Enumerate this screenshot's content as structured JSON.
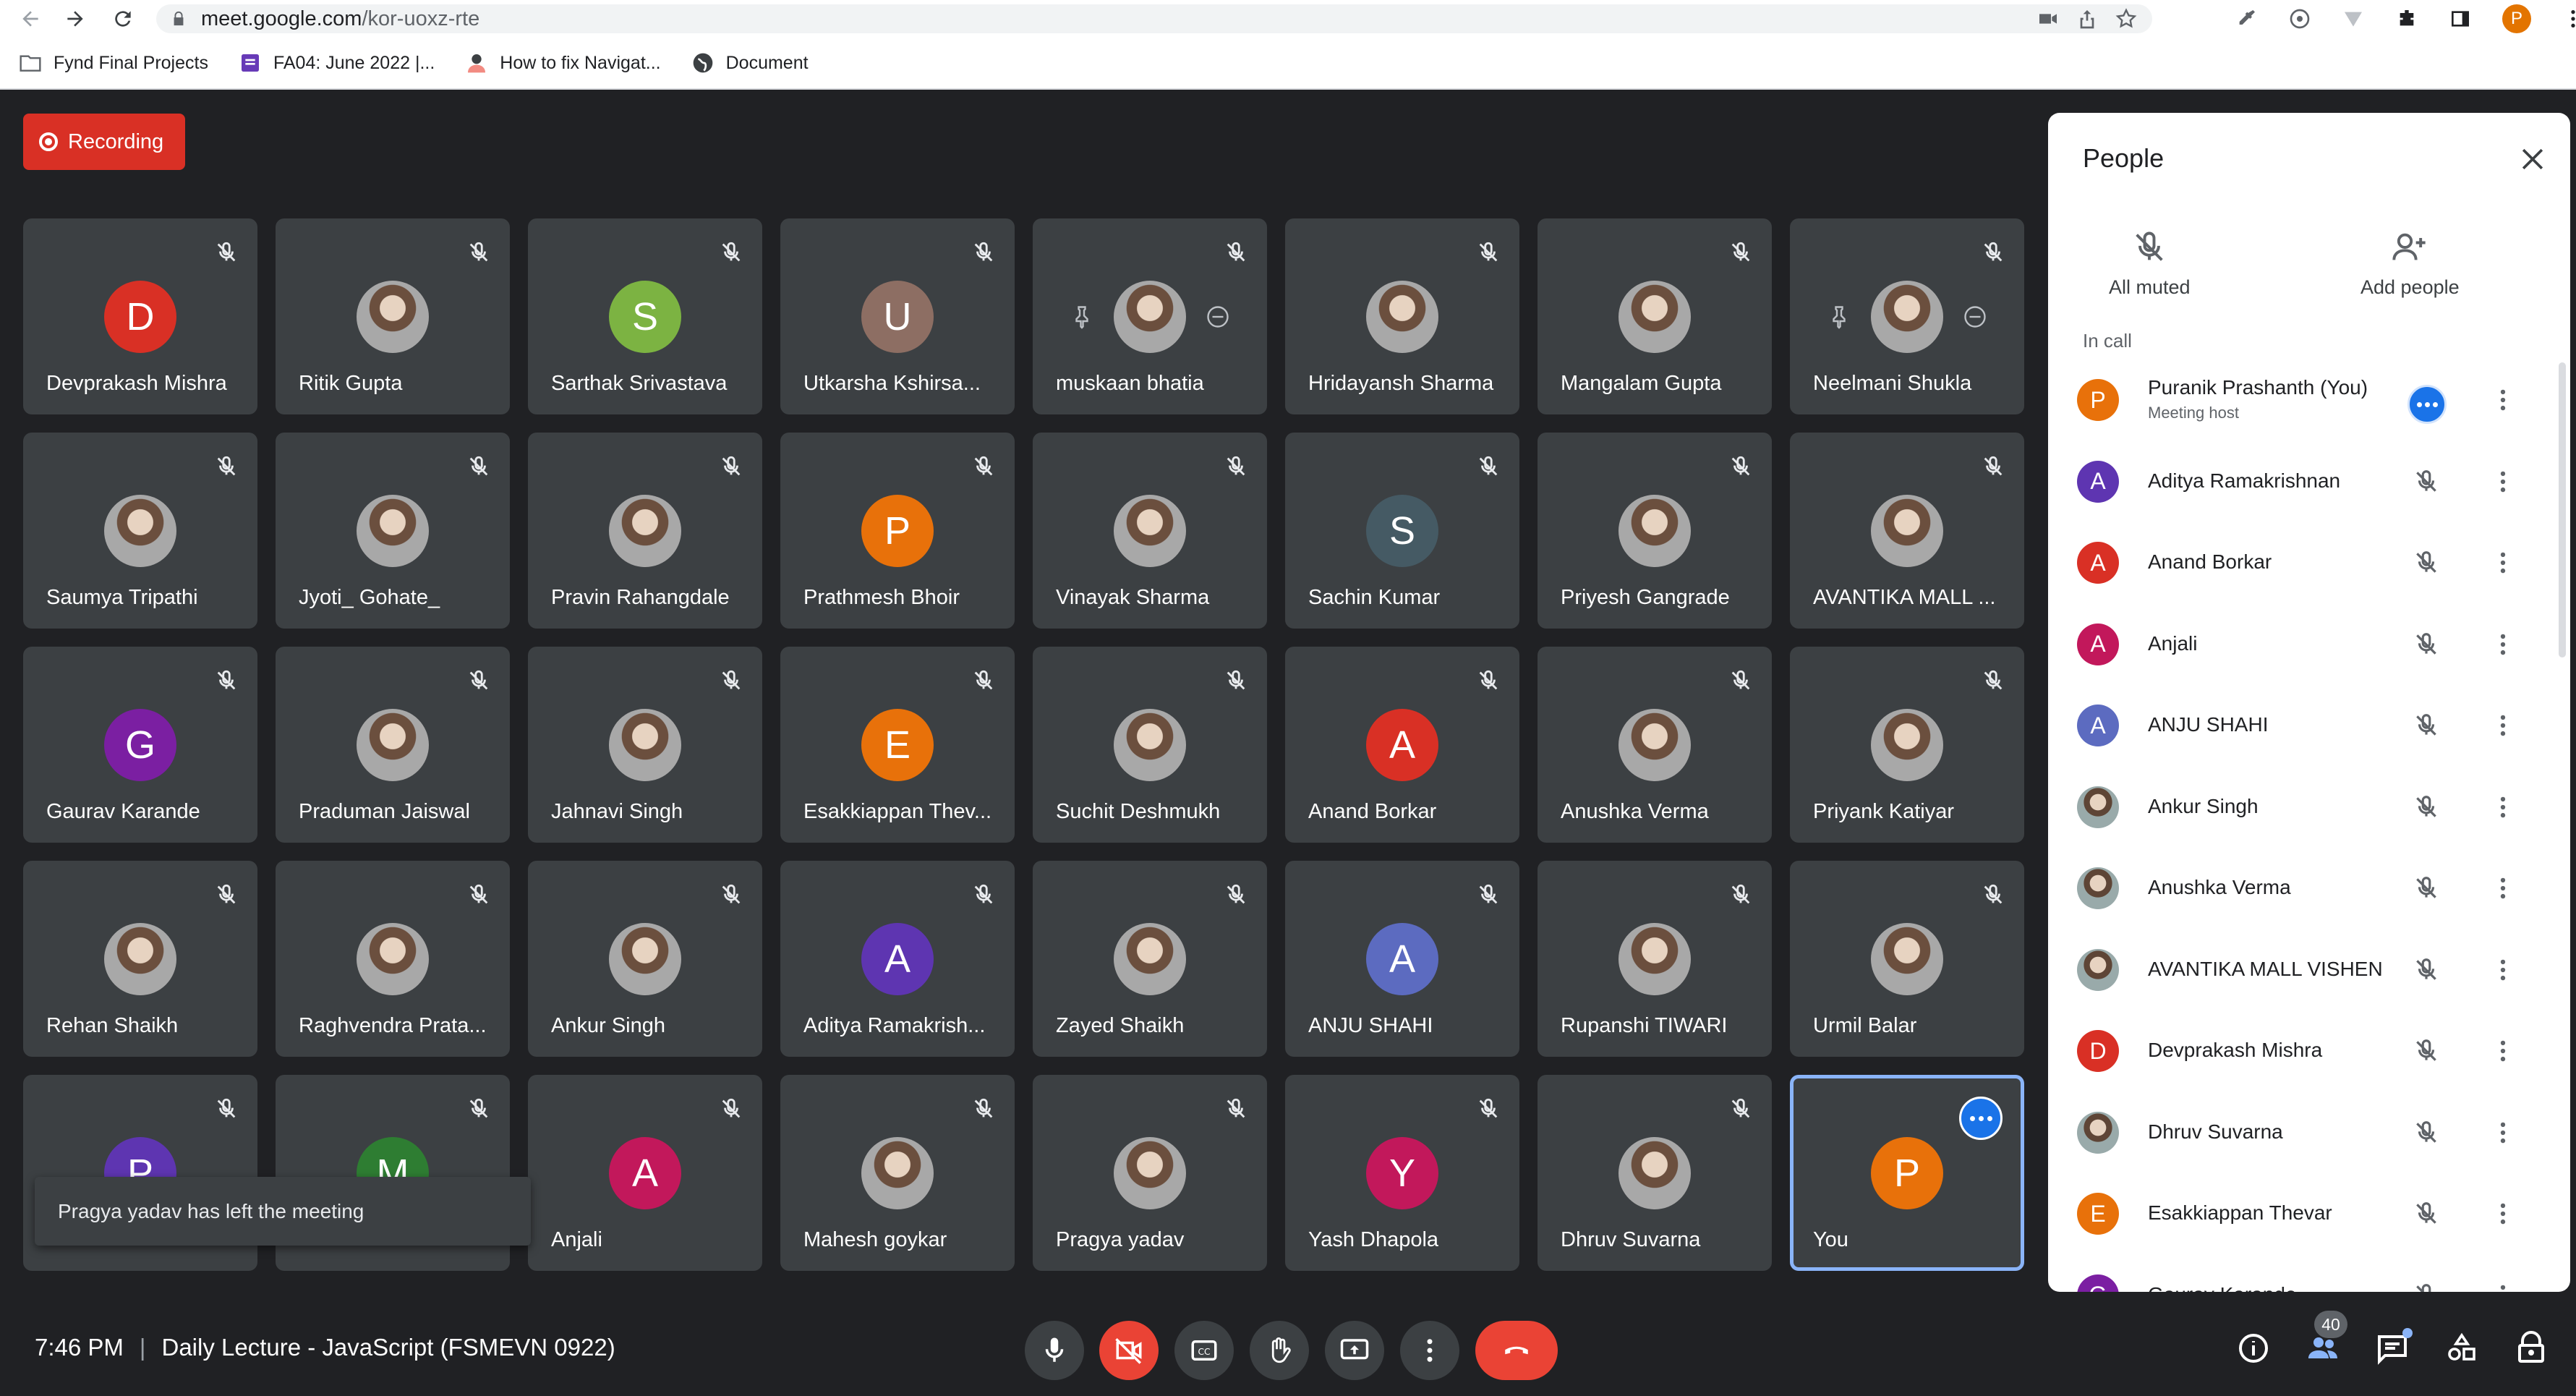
{
  "browser": {
    "url_host": "meet.google.com",
    "url_path": "/kor-uoxz-rte",
    "profile_initial": "P",
    "bookmarks": [
      "Fynd Final Projects",
      "FA04: June 2022 |...",
      "How to fix Navigat...",
      "Document"
    ]
  },
  "recording_label": "Recording",
  "tiles": [
    {
      "name": "Devprakash Mishra",
      "initial": "D",
      "color": "#d93025"
    },
    {
      "name": "Ritik Gupta",
      "initial": "",
      "color": "",
      "photo": true
    },
    {
      "name": "Sarthak Srivastava",
      "initial": "S",
      "color": "#7cb342"
    },
    {
      "name": "Utkarsha Kshirsa...",
      "initial": "U",
      "color": "#8d6e63"
    },
    {
      "name": "muskaan bhatia",
      "initial": "",
      "color": "",
      "photo": true,
      "pinnable": true
    },
    {
      "name": "Hridayansh Sharma",
      "initial": "",
      "color": "",
      "photo": true
    },
    {
      "name": "Mangalam Gupta",
      "initial": "",
      "color": "",
      "photo": true
    },
    {
      "name": "Neelmani Shukla",
      "initial": "",
      "color": "",
      "photo": true,
      "pinnable": true
    },
    {
      "name": "Saumya Tripathi",
      "initial": "",
      "color": "",
      "photo": true
    },
    {
      "name": "Jyoti_ Gohate_",
      "initial": "",
      "color": "",
      "photo": true
    },
    {
      "name": "Pravin Rahangdale",
      "initial": "",
      "color": "",
      "photo": true
    },
    {
      "name": "Prathmesh Bhoir",
      "initial": "P",
      "color": "#e8710a"
    },
    {
      "name": "Vinayak Sharma",
      "initial": "",
      "color": "",
      "photo": true
    },
    {
      "name": "Sachin Kumar",
      "initial": "S",
      "color": "#455a64"
    },
    {
      "name": "Priyesh Gangrade",
      "initial": "",
      "color": "",
      "photo": true
    },
    {
      "name": "AVANTIKA MALL ...",
      "initial": "",
      "color": "",
      "photo": true
    },
    {
      "name": "Gaurav Karande",
      "initial": "G",
      "color": "#7b1fa2"
    },
    {
      "name": "Praduman Jaiswal",
      "initial": "",
      "color": "",
      "photo": true
    },
    {
      "name": "Jahnavi Singh",
      "initial": "",
      "color": "",
      "photo": true
    },
    {
      "name": "Esakkiappan Thev...",
      "initial": "E",
      "color": "#e8710a"
    },
    {
      "name": "Suchit Deshmukh",
      "initial": "",
      "color": "",
      "photo": true
    },
    {
      "name": "Anand Borkar",
      "initial": "A",
      "color": "#d93025"
    },
    {
      "name": "Anushka Verma",
      "initial": "",
      "color": "",
      "photo": true
    },
    {
      "name": "Priyank Katiyar",
      "initial": "",
      "color": "",
      "photo": true
    },
    {
      "name": "Rehan Shaikh",
      "initial": "",
      "color": "",
      "photo": true
    },
    {
      "name": "Raghvendra Prata...",
      "initial": "",
      "color": "",
      "photo": true
    },
    {
      "name": "Ankur Singh",
      "initial": "",
      "color": "",
      "photo": true
    },
    {
      "name": "Aditya Ramakrish...",
      "initial": "A",
      "color": "#5e35b1"
    },
    {
      "name": "Zayed Shaikh",
      "initial": "",
      "color": "",
      "photo": true
    },
    {
      "name": "ANJU SHAHI",
      "initial": "A",
      "color": "#5c6bc0"
    },
    {
      "name": "Rupanshi TIWARI",
      "initial": "",
      "color": "",
      "photo": true
    },
    {
      "name": "Urmil Balar",
      "initial": "",
      "color": "",
      "photo": true
    },
    {
      "name": "",
      "initial": "P",
      "color": "#5e35b1"
    },
    {
      "name": "",
      "initial": "M",
      "color": "#2e7d32"
    },
    {
      "name": "Anjali",
      "initial": "A",
      "color": "#c2185b"
    },
    {
      "name": "Mahesh goykar",
      "initial": "",
      "color": "",
      "photo": true
    },
    {
      "name": "Pragya yadav",
      "initial": "",
      "color": "",
      "photo": true
    },
    {
      "name": "Yash Dhapola",
      "initial": "Y",
      "color": "#c2185b"
    },
    {
      "name": "Dhruv Suvarna",
      "initial": "",
      "color": "",
      "photo": true
    },
    {
      "name": "You",
      "initial": "P",
      "color": "#e8710a",
      "self": true
    }
  ],
  "toast": "Pragya yadav has left the meeting",
  "people_panel": {
    "title": "People",
    "all_muted": "All muted",
    "add_people": "Add people",
    "in_call": "In call",
    "host_label": "Meeting host",
    "people": [
      {
        "name": "Puranik Prashanth (You)",
        "initial": "P",
        "color": "#e8710a",
        "host": true
      },
      {
        "name": "Aditya Ramakrishnan",
        "initial": "A",
        "color": "#5e35b1"
      },
      {
        "name": "Anand Borkar",
        "initial": "A",
        "color": "#d93025"
      },
      {
        "name": "Anjali",
        "initial": "A",
        "color": "#c2185b"
      },
      {
        "name": "ANJU SHAHI",
        "initial": "A",
        "color": "#5c6bc0"
      },
      {
        "name": "Ankur Singh",
        "initial": "",
        "color": "",
        "photo": true
      },
      {
        "name": "Anushka Verma",
        "initial": "",
        "color": "",
        "photo": true
      },
      {
        "name": "AVANTIKA MALL VISHEN",
        "initial": "",
        "color": "",
        "photo": true
      },
      {
        "name": "Devprakash Mishra",
        "initial": "D",
        "color": "#d93025"
      },
      {
        "name": "Dhruv Suvarna",
        "initial": "",
        "color": "",
        "photo": true
      },
      {
        "name": "Esakkiappan Thevar",
        "initial": "E",
        "color": "#e8710a"
      },
      {
        "name": "Gaurav Karande",
        "initial": "G",
        "color": "#7b1fa2"
      }
    ]
  },
  "bottom_bar": {
    "time": "7:46 PM",
    "separator": "|",
    "meeting_title": "Daily Lecture - JavaScript (FSMEVN 0922)",
    "people_count": "40"
  }
}
